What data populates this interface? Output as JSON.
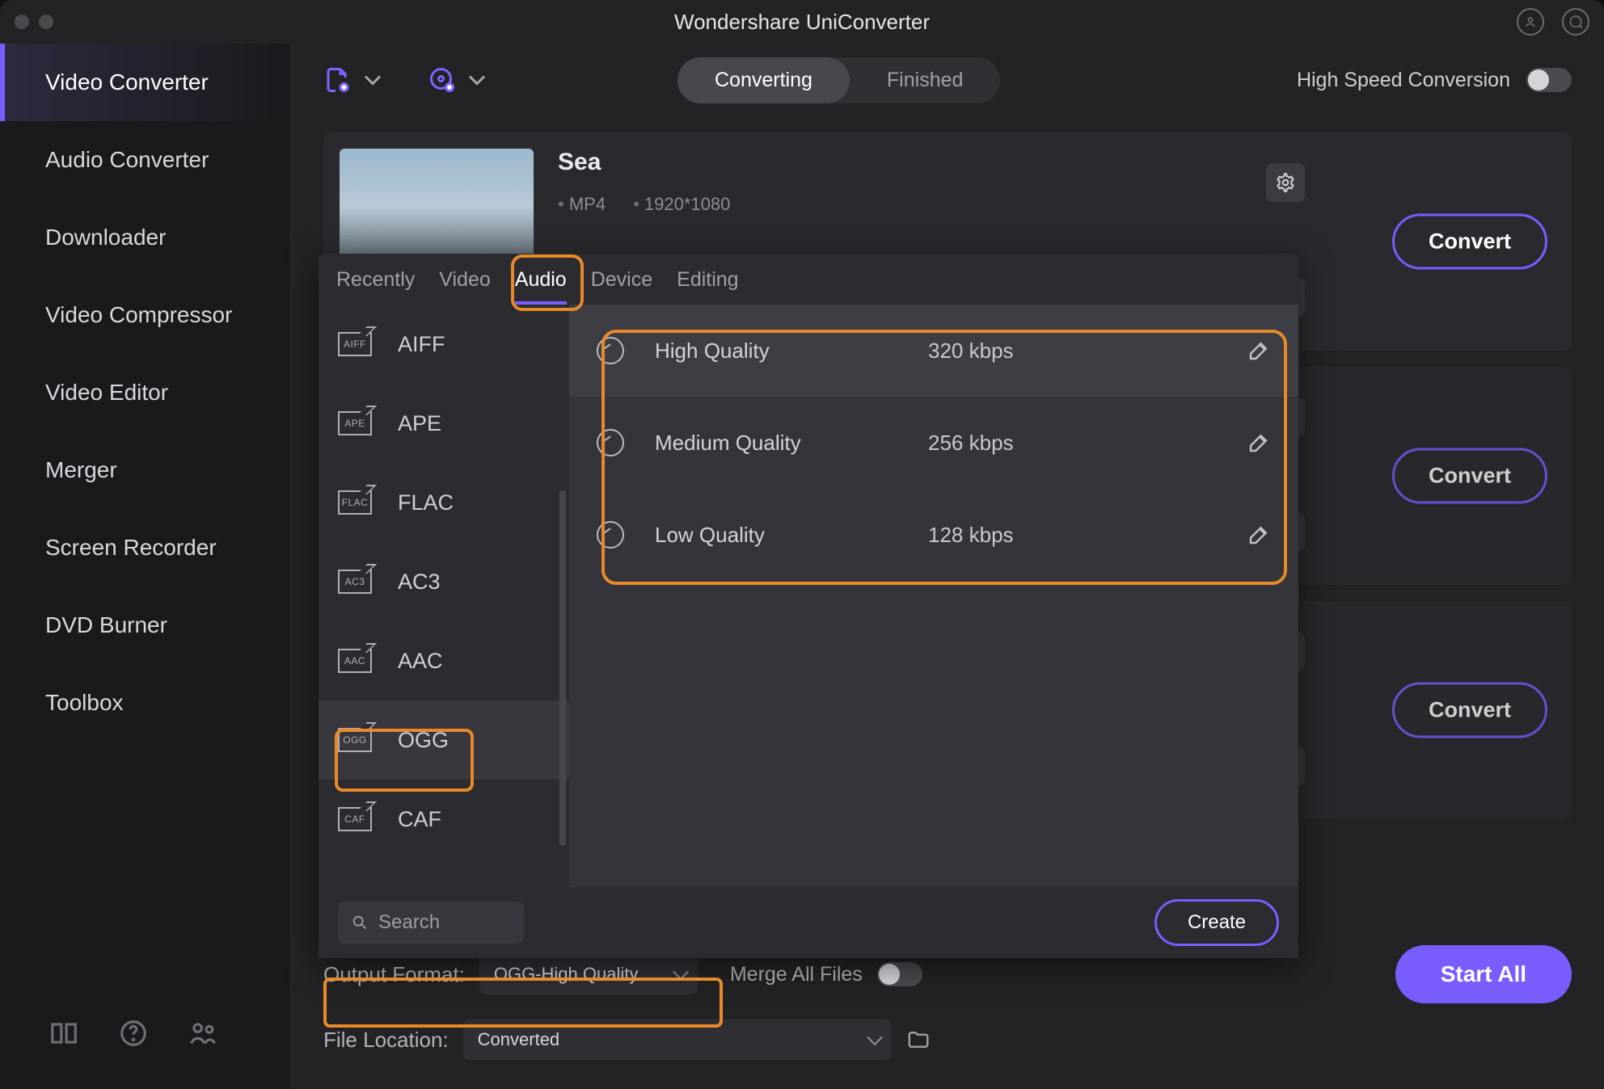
{
  "app_title": "Wondershare UniConverter",
  "sidebar": {
    "items": [
      {
        "label": "Video Converter"
      },
      {
        "label": "Audio Converter"
      },
      {
        "label": "Downloader"
      },
      {
        "label": "Video Compressor"
      },
      {
        "label": "Video Editor"
      },
      {
        "label": "Merger"
      },
      {
        "label": "Screen Recorder"
      },
      {
        "label": "DVD Burner"
      },
      {
        "label": "Toolbox"
      }
    ]
  },
  "toolbar": {
    "tab_converting": "Converting",
    "tab_finished": "Finished",
    "high_speed_label": "High Speed Conversion"
  },
  "file": {
    "title": "Sea",
    "format": "MP4",
    "resolution": "1920*1080",
    "convert_btn": "Convert"
  },
  "popup": {
    "tabs": {
      "recently": "Recently",
      "video": "Video",
      "audio": "Audio",
      "device": "Device",
      "editing": "Editing"
    },
    "formats": [
      {
        "label": "AIFF",
        "tag": "AIFF"
      },
      {
        "label": "APE",
        "tag": "APE"
      },
      {
        "label": "FLAC",
        "tag": "FLAC"
      },
      {
        "label": "AC3",
        "tag": "AC3"
      },
      {
        "label": "AAC",
        "tag": "AAC"
      },
      {
        "label": "OGG",
        "tag": "OGG"
      },
      {
        "label": "CAF",
        "tag": "CAF"
      }
    ],
    "qualities": [
      {
        "label": "High Quality",
        "rate": "320 kbps"
      },
      {
        "label": "Medium Quality",
        "rate": "256 kbps"
      },
      {
        "label": "Low Quality",
        "rate": "128 kbps"
      }
    ],
    "search_placeholder": "Search",
    "create_btn": "Create"
  },
  "bottom": {
    "output_format_label": "Output Format:",
    "output_format_value": "OGG-High Quality",
    "merge_label": "Merge All Files",
    "file_location_label": "File Location:",
    "file_location_value": "Converted",
    "start_all": "Start All"
  }
}
